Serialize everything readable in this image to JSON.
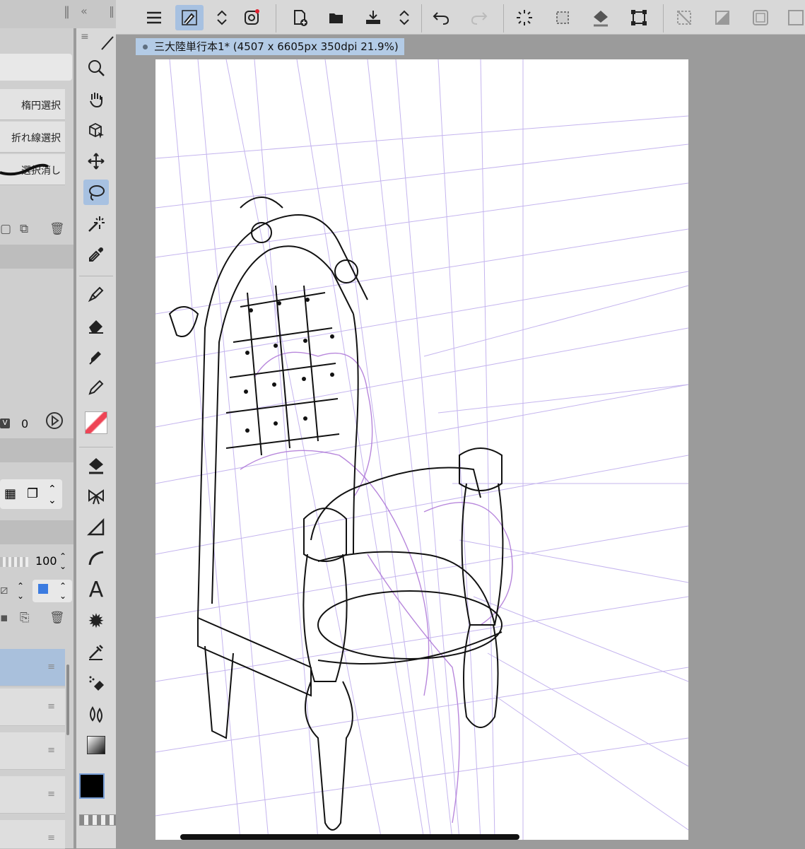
{
  "document": {
    "tab_title": "三大陸単行本1* (4507 x 6605px 350dpi 21.9%)"
  },
  "selection_panel": {
    "ellipse_select": "楕円選択",
    "polyline_select": "折れ線選択",
    "deselect": "選択消し"
  },
  "brush_panel": {
    "v_label": "V",
    "v_value": "0"
  },
  "layer_panel": {
    "opacity_value": "100"
  },
  "tools": [
    "zoom-icon",
    "hand-icon",
    "object-icon",
    "move-icon",
    "lasso-icon",
    "magic-wand-icon",
    "eyedropper-icon",
    "pen-icon",
    "eraser-icon",
    "marker-icon",
    "pencil-icon",
    "brush-thumbnail-icon",
    "fill-icon",
    "bow-icon",
    "ruler-icon",
    "curve-icon",
    "text-icon",
    "effect-icon",
    "blend-icon",
    "fill-sub-icon",
    "water-icon",
    "gradient-icon"
  ],
  "colors": {
    "main": "#000000",
    "sub": "#ffffff",
    "accent": "#a7c1e1",
    "perspective_line": "#b8a6e6"
  }
}
